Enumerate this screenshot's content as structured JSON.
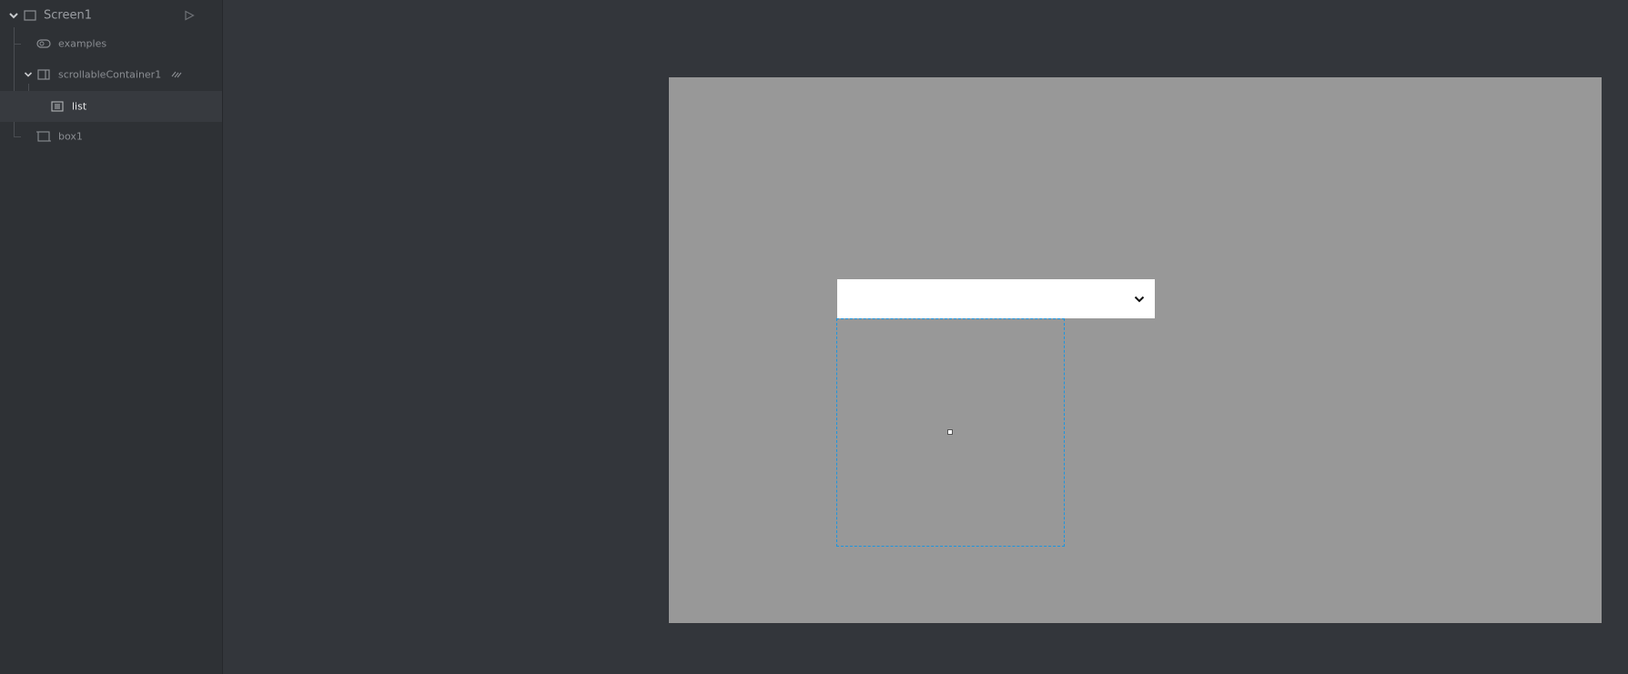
{
  "tree": {
    "root": {
      "label": "Screen1",
      "icon": "screen-icon"
    },
    "items": [
      {
        "label": "examples",
        "icon": "toggle-icon"
      },
      {
        "label": "scrollableContainer1",
        "icon": "scrollable-container-icon"
      },
      {
        "label": "list",
        "icon": "list-icon",
        "selected": true
      },
      {
        "label": "box1",
        "icon": "box-icon"
      }
    ]
  },
  "canvas": {
    "background": "#989898",
    "dropdown": {
      "value": ""
    },
    "selection_color": "#1b95e0"
  }
}
